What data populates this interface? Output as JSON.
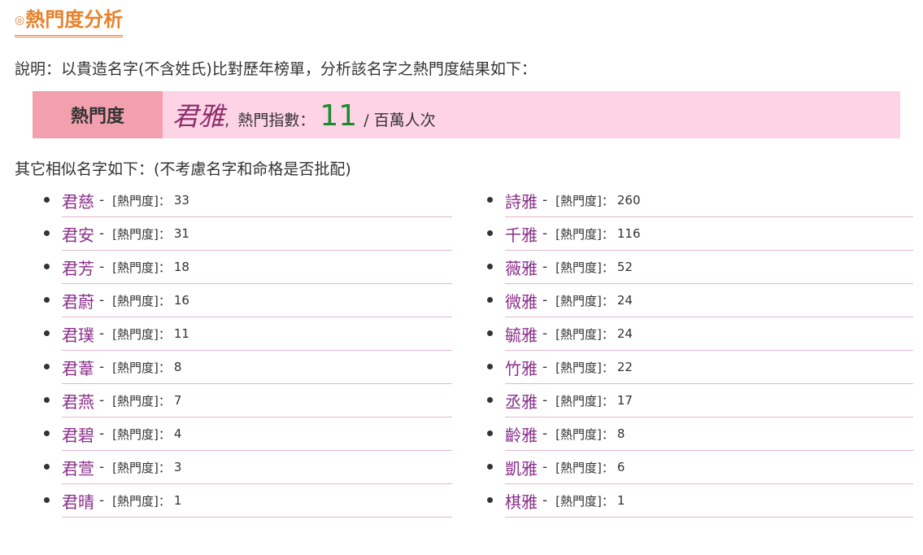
{
  "header": {
    "mark": "◎",
    "title": "熱門度分析"
  },
  "description": "說明：以貴造名字(不含姓氏)比對歷年榜單，分析該名字之熱門度結果如下：",
  "popularity": {
    "label": "熱門度",
    "name": "君雅",
    "comma": ",",
    "index_label": "熱門指數：",
    "value": "11",
    "unit": "/ 百萬人次"
  },
  "similar_title": "其它相似名字如下：(不考慮名字和命格是否批配)",
  "metric_label": "[熱門度]：",
  "dash": "-",
  "left_list": [
    {
      "name": "君慈",
      "value": "33"
    },
    {
      "name": "君安",
      "value": "31"
    },
    {
      "name": "君芳",
      "value": "18"
    },
    {
      "name": "君蔚",
      "value": "16"
    },
    {
      "name": "君璞",
      "value": "11"
    },
    {
      "name": "君葦",
      "value": "8"
    },
    {
      "name": "君燕",
      "value": "7"
    },
    {
      "name": "君碧",
      "value": "4"
    },
    {
      "name": "君萱",
      "value": "3"
    },
    {
      "name": "君晴",
      "value": "1"
    }
  ],
  "right_list": [
    {
      "name": "詩雅",
      "value": "260"
    },
    {
      "name": "千雅",
      "value": "116"
    },
    {
      "name": "薇雅",
      "value": "52"
    },
    {
      "name": "微雅",
      "value": "24"
    },
    {
      "name": "毓雅",
      "value": "24"
    },
    {
      "name": "竹雅",
      "value": "22"
    },
    {
      "name": "丞雅",
      "value": "17"
    },
    {
      "name": "齡雅",
      "value": "8"
    },
    {
      "name": "凱雅",
      "value": "6"
    },
    {
      "name": "棋雅",
      "value": "1"
    }
  ]
}
